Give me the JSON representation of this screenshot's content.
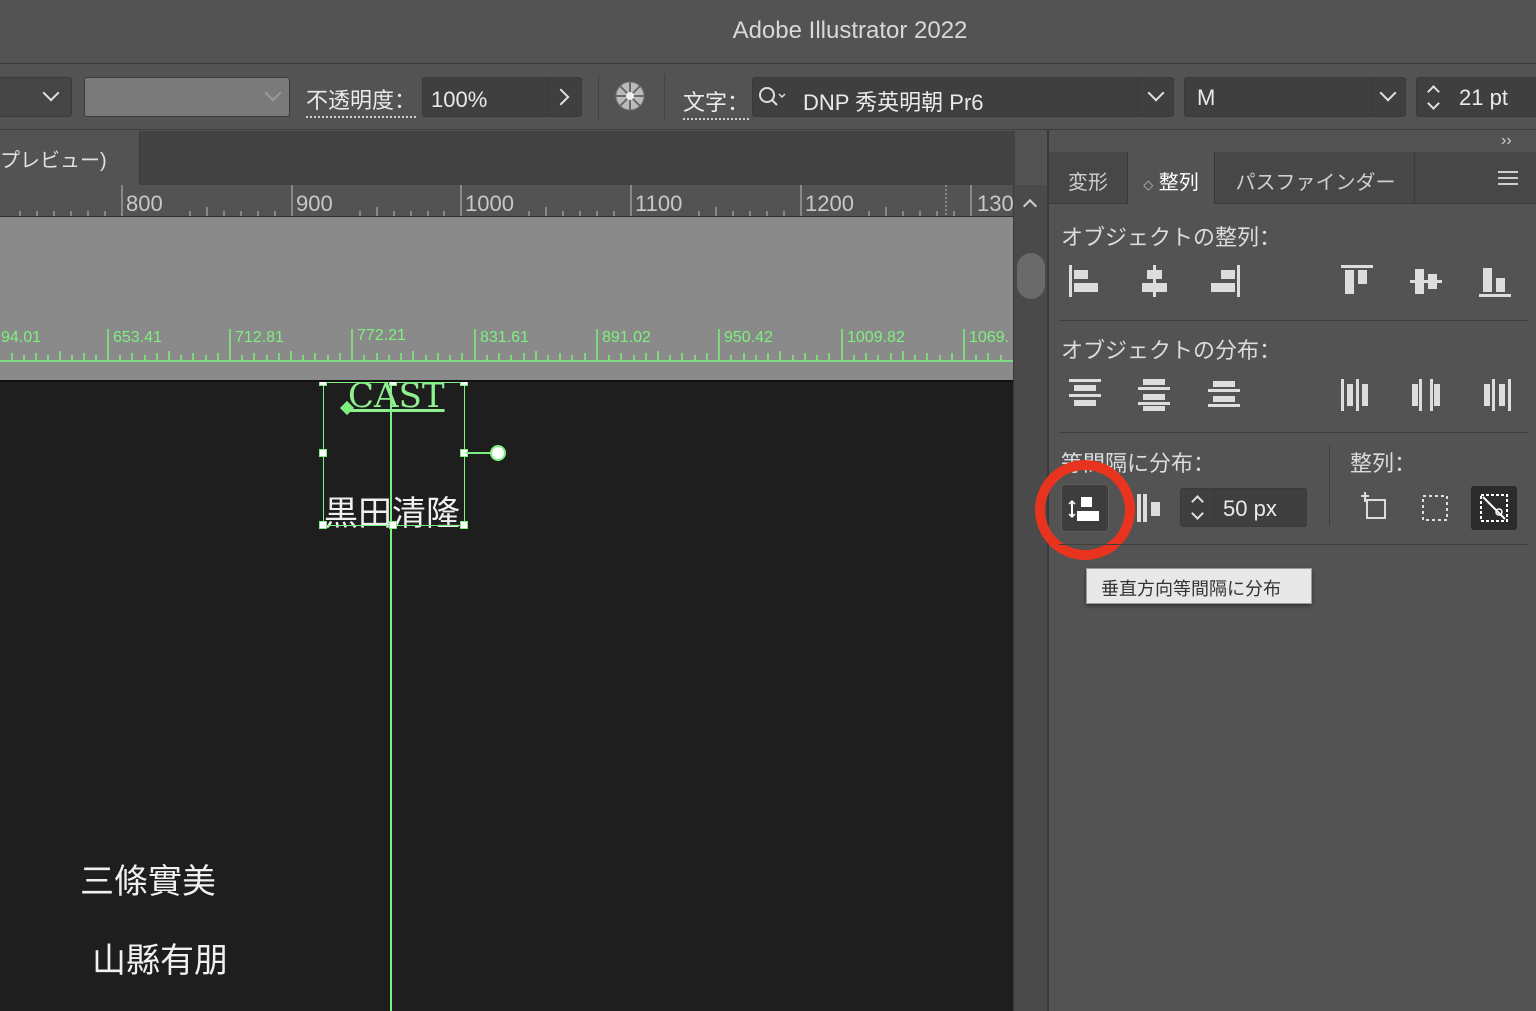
{
  "app": {
    "title": "Adobe Illustrator 2022"
  },
  "controlbar": {
    "opacity_label": "不透明度：",
    "opacity_value": "100%",
    "char_label": "文字：",
    "font_family": "DNP 秀英明朝 Pr6",
    "font_style": "M",
    "font_size": "21 pt"
  },
  "document_tab": {
    "label": "プレビュー)"
  },
  "ruler_top": {
    "ticks": [
      "800",
      "900",
      "1000",
      "1100",
      "1200",
      "130"
    ]
  },
  "guide_ruler": {
    "labels": [
      "94.01",
      "653.41",
      "712.81",
      "772.21",
      "831.61",
      "891.02",
      "950.42",
      "1009.82",
      "1069."
    ]
  },
  "artboard": {
    "selected_title": "CAST",
    "selected_name": "黒田清隆",
    "names": [
      "三條實美",
      "山縣有朋"
    ]
  },
  "panel": {
    "collapse_glyph": "››",
    "tabs": [
      {
        "label": "変形",
        "active": false
      },
      {
        "label": "整列",
        "active": true
      },
      {
        "label": "パスファインダー",
        "active": false
      }
    ],
    "align_objects_title": "オブジェクトの整列：",
    "distribute_objects_title": "オブジェクトの分布：",
    "distribute_spacing_title": "等間隔に分布：",
    "align_to_title": "整列：",
    "spacing_value": "50 px",
    "tooltip": "垂直方向等間隔に分布"
  },
  "colors": {
    "guide": "#7ef07e",
    "highlight_ring": "#e8331f",
    "panel_bg": "#535353",
    "artboard_bg": "#1e1e1e"
  }
}
